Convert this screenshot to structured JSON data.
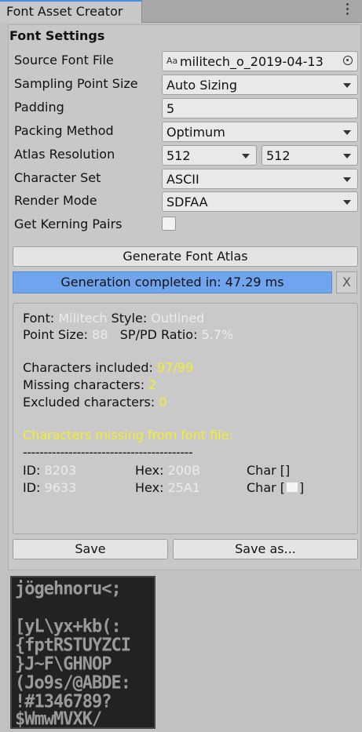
{
  "tab": {
    "title": "Font Asset Creator"
  },
  "section_title": "Font Settings",
  "fields": {
    "source_font_file": {
      "label": "Source Font File",
      "value": "militech_o_2019-04-13",
      "icon": "Aa"
    },
    "sampling_point_size": {
      "label": "Sampling Point Size",
      "value": "Auto Sizing"
    },
    "padding": {
      "label": "Padding",
      "value": "5"
    },
    "packing_method": {
      "label": "Packing Method",
      "value": "Optimum"
    },
    "atlas_resolution": {
      "label": "Atlas Resolution",
      "width": "512",
      "height": "512"
    },
    "character_set": {
      "label": "Character Set",
      "value": "ASCII"
    },
    "render_mode": {
      "label": "Render Mode",
      "value": "SDFAA"
    },
    "get_kerning_pairs": {
      "label": "Get Kerning Pairs",
      "checked": false
    }
  },
  "generate_button": "Generate Font Atlas",
  "progress": {
    "text": "Generation completed in: 47.29 ms",
    "value": 1.0,
    "close": "X"
  },
  "info": {
    "font_label": "Font:",
    "font_value": "Militech",
    "style_label": "Style:",
    "style_value": "Outlined",
    "point_size_label": "Point Size:",
    "point_size_value": "88",
    "ratio_label": "SP/PD Ratio:",
    "ratio_value": "5.7%",
    "included_label": "Characters included:",
    "included_value": "97/99",
    "missing_label": "Missing characters:",
    "missing_value": "2",
    "excluded_label": "Excluded characters:",
    "excluded_value": "0",
    "missing_header": "Characters missing from font file:",
    "separator": "-----------------------------------------",
    "rows": [
      {
        "id_label": "ID:",
        "id": "8203",
        "hex_label": "Hex:",
        "hex": "200B",
        "char_label": "Char"
      },
      {
        "id_label": "ID:",
        "id": "9633",
        "hex_label": "Hex:",
        "hex": "25A1",
        "char_label": "Char"
      }
    ]
  },
  "buttons": {
    "save": "Save",
    "save_as": "Save as..."
  },
  "atlas_preview": {
    "rows": [
      "jögehnoru<;",
      "[yL\\yx+kb(:",
      "{fptRSTUYZCI",
      "}J~F\\GHNOP",
      "(Jo9s/@ABDE:",
      "!#1346789?",
      "$WmwMVXK/"
    ]
  },
  "colors": {
    "accent": "#6fa4ef",
    "value_white": "#ececec",
    "value_yellow": "#f5ef2a"
  }
}
